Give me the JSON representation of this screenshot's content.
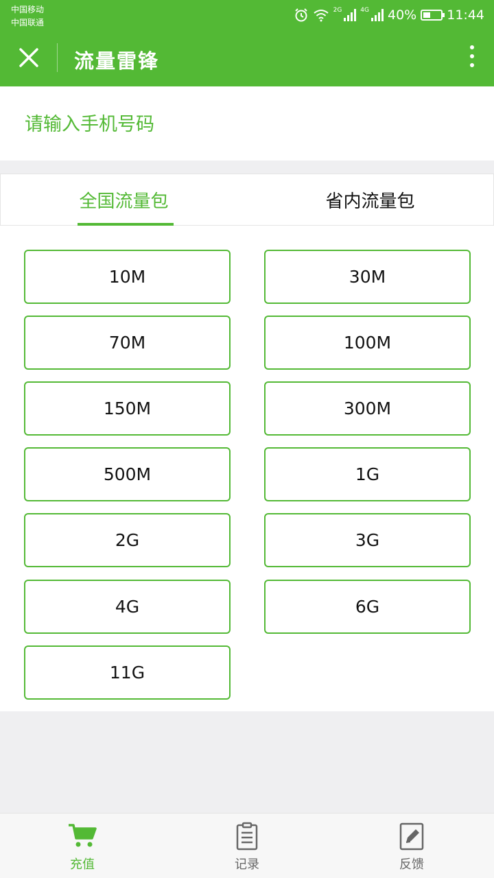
{
  "status_bar": {
    "carrier_1": "中国移动",
    "carrier_2": "中国联通",
    "net_1": "2G",
    "net_2": "4G",
    "battery": "40%",
    "time": "11:44"
  },
  "header": {
    "title": "流量雷锋",
    "close_icon": "close-icon",
    "more_icon": "more-vertical-icon"
  },
  "phone": {
    "placeholder": "请输入手机号码",
    "value": ""
  },
  "tabs": [
    {
      "label": "全国流量包",
      "active": true
    },
    {
      "label": "省内流量包",
      "active": false
    }
  ],
  "packages": [
    "10M",
    "30M",
    "70M",
    "100M",
    "150M",
    "300M",
    "500M",
    "1G",
    "2G",
    "3G",
    "4G",
    "6G",
    "11G"
  ],
  "bottom_nav": [
    {
      "label": "充值",
      "icon": "cart-icon",
      "active": true
    },
    {
      "label": "记录",
      "icon": "clipboard-icon",
      "active": false
    },
    {
      "label": "反馈",
      "icon": "edit-icon",
      "active": false
    }
  ],
  "colors": {
    "accent": "#53b935",
    "background": "#efeff1"
  }
}
